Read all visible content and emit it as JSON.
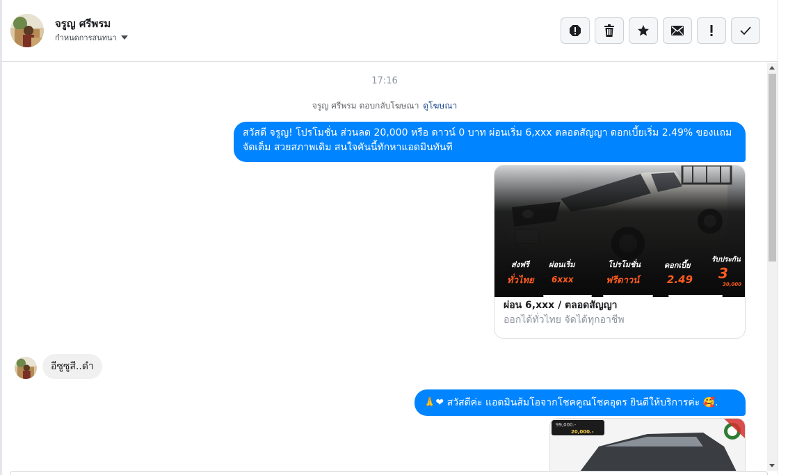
{
  "header": {
    "name": "จรูญ ศรีพรม",
    "assign_label": "กำหนดการสนทนา",
    "toolbar": [
      "spam-icon",
      "trash-icon",
      "star-icon",
      "envelope-icon",
      "exclamation-icon",
      "check-icon"
    ]
  },
  "conversation": {
    "timestamp": "17:16",
    "ad_reply_notice": "จรูญ ศรีพรม ตอบกลับโฆษณา",
    "view_ad_link": "ดูโฆษณา",
    "messages": [
      {
        "direction": "outgoing",
        "text": "สวัสดี จรูญ! โปรโมชั่น ส่วนลด 20,000 หรือ ดาวน์ 0 บาท ผ่อนเริ่ม 6,xxx ตลอดสัญญา ดอกเบี้ยเริ่ม 2.49% ของแถมจัดเต็ม สวยสภาพเดิม สนใจคันนี้ทักหาแอดมินทันที"
      },
      {
        "direction": "outgoing",
        "type": "ad-card",
        "image": {
          "labels": [
            {
              "top": "ส่งฟรี",
              "bottom": "ทั่วไทย"
            },
            {
              "top": "ผ่อนเริ่ม",
              "bottom": "6xxx"
            },
            {
              "top": "โปรโมชั่น",
              "bottom": "ฟรีดาวน์"
            },
            {
              "top": "ดอกเบี้ย",
              "bottom": "2.49"
            },
            {
              "top": "รับประกัน",
              "bottom": "3"
            }
          ],
          "small_text": "30,000"
        },
        "title": "ผ่อน 6,xxx / ตลอดสัญญา",
        "description": "ออกได้ทั่วไทย จัดได้ทุกอาชีพ"
      },
      {
        "direction": "incoming",
        "text": "อีซูซูสี..ดำ"
      },
      {
        "direction": "outgoing",
        "text": "สวัสดีค่ะ แอดมินส้มโอจากโชคคูณโชคอุดร ยินดีให้บริการค่ะ",
        "emoji_prefix": "🙏❤",
        "emoji_suffix": "🥰."
      },
      {
        "direction": "outgoing",
        "type": "image",
        "text_top": "99,000.-",
        "text_bottom": "20,000.-"
      }
    ]
  },
  "colors": {
    "outgoing_bubble": "#0084ff",
    "incoming_bubble": "#f1f0f0",
    "link": "#1c4a8f"
  }
}
